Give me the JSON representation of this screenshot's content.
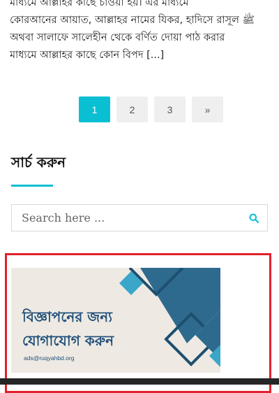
{
  "article": {
    "lines": [
      "মাধ্যমে আল্লাহর কাছে চাওয়া হয়। এর মাধ্যমে",
      "কোরআনের আয়াত, আল্লাহর নামের যিকর, হাদিসে রাসূল ﷺ",
      "অথবা সালাফে সালেহীন থেকে বর্ণিত দোয়া পাঠ করার",
      "মাধ্যমে আল্লাহর কাছে কোন বিপদ [...]"
    ]
  },
  "pagination": {
    "pages": [
      "1",
      "2",
      "3"
    ],
    "active": "1",
    "next_label": "»"
  },
  "search_widget": {
    "title": "সার্চ করুন",
    "placeholder": "Search here ..."
  },
  "ad": {
    "headline_1": "বিজ্ঞাপনের জন্য",
    "headline_2": "যোগাযোগ করুন",
    "email": "ads@ruqyahbd.org"
  },
  "colors": {
    "accent": "#0bbfd3",
    "ad_border": "#e0212b",
    "ad_text": "#1f4e79",
    "ad_background": "#eeeae3",
    "ad_shape_dark": "#2e6a8e",
    "ad_shape_light": "#3aa6c9"
  },
  "icons": {
    "search_button": "search-icon"
  }
}
